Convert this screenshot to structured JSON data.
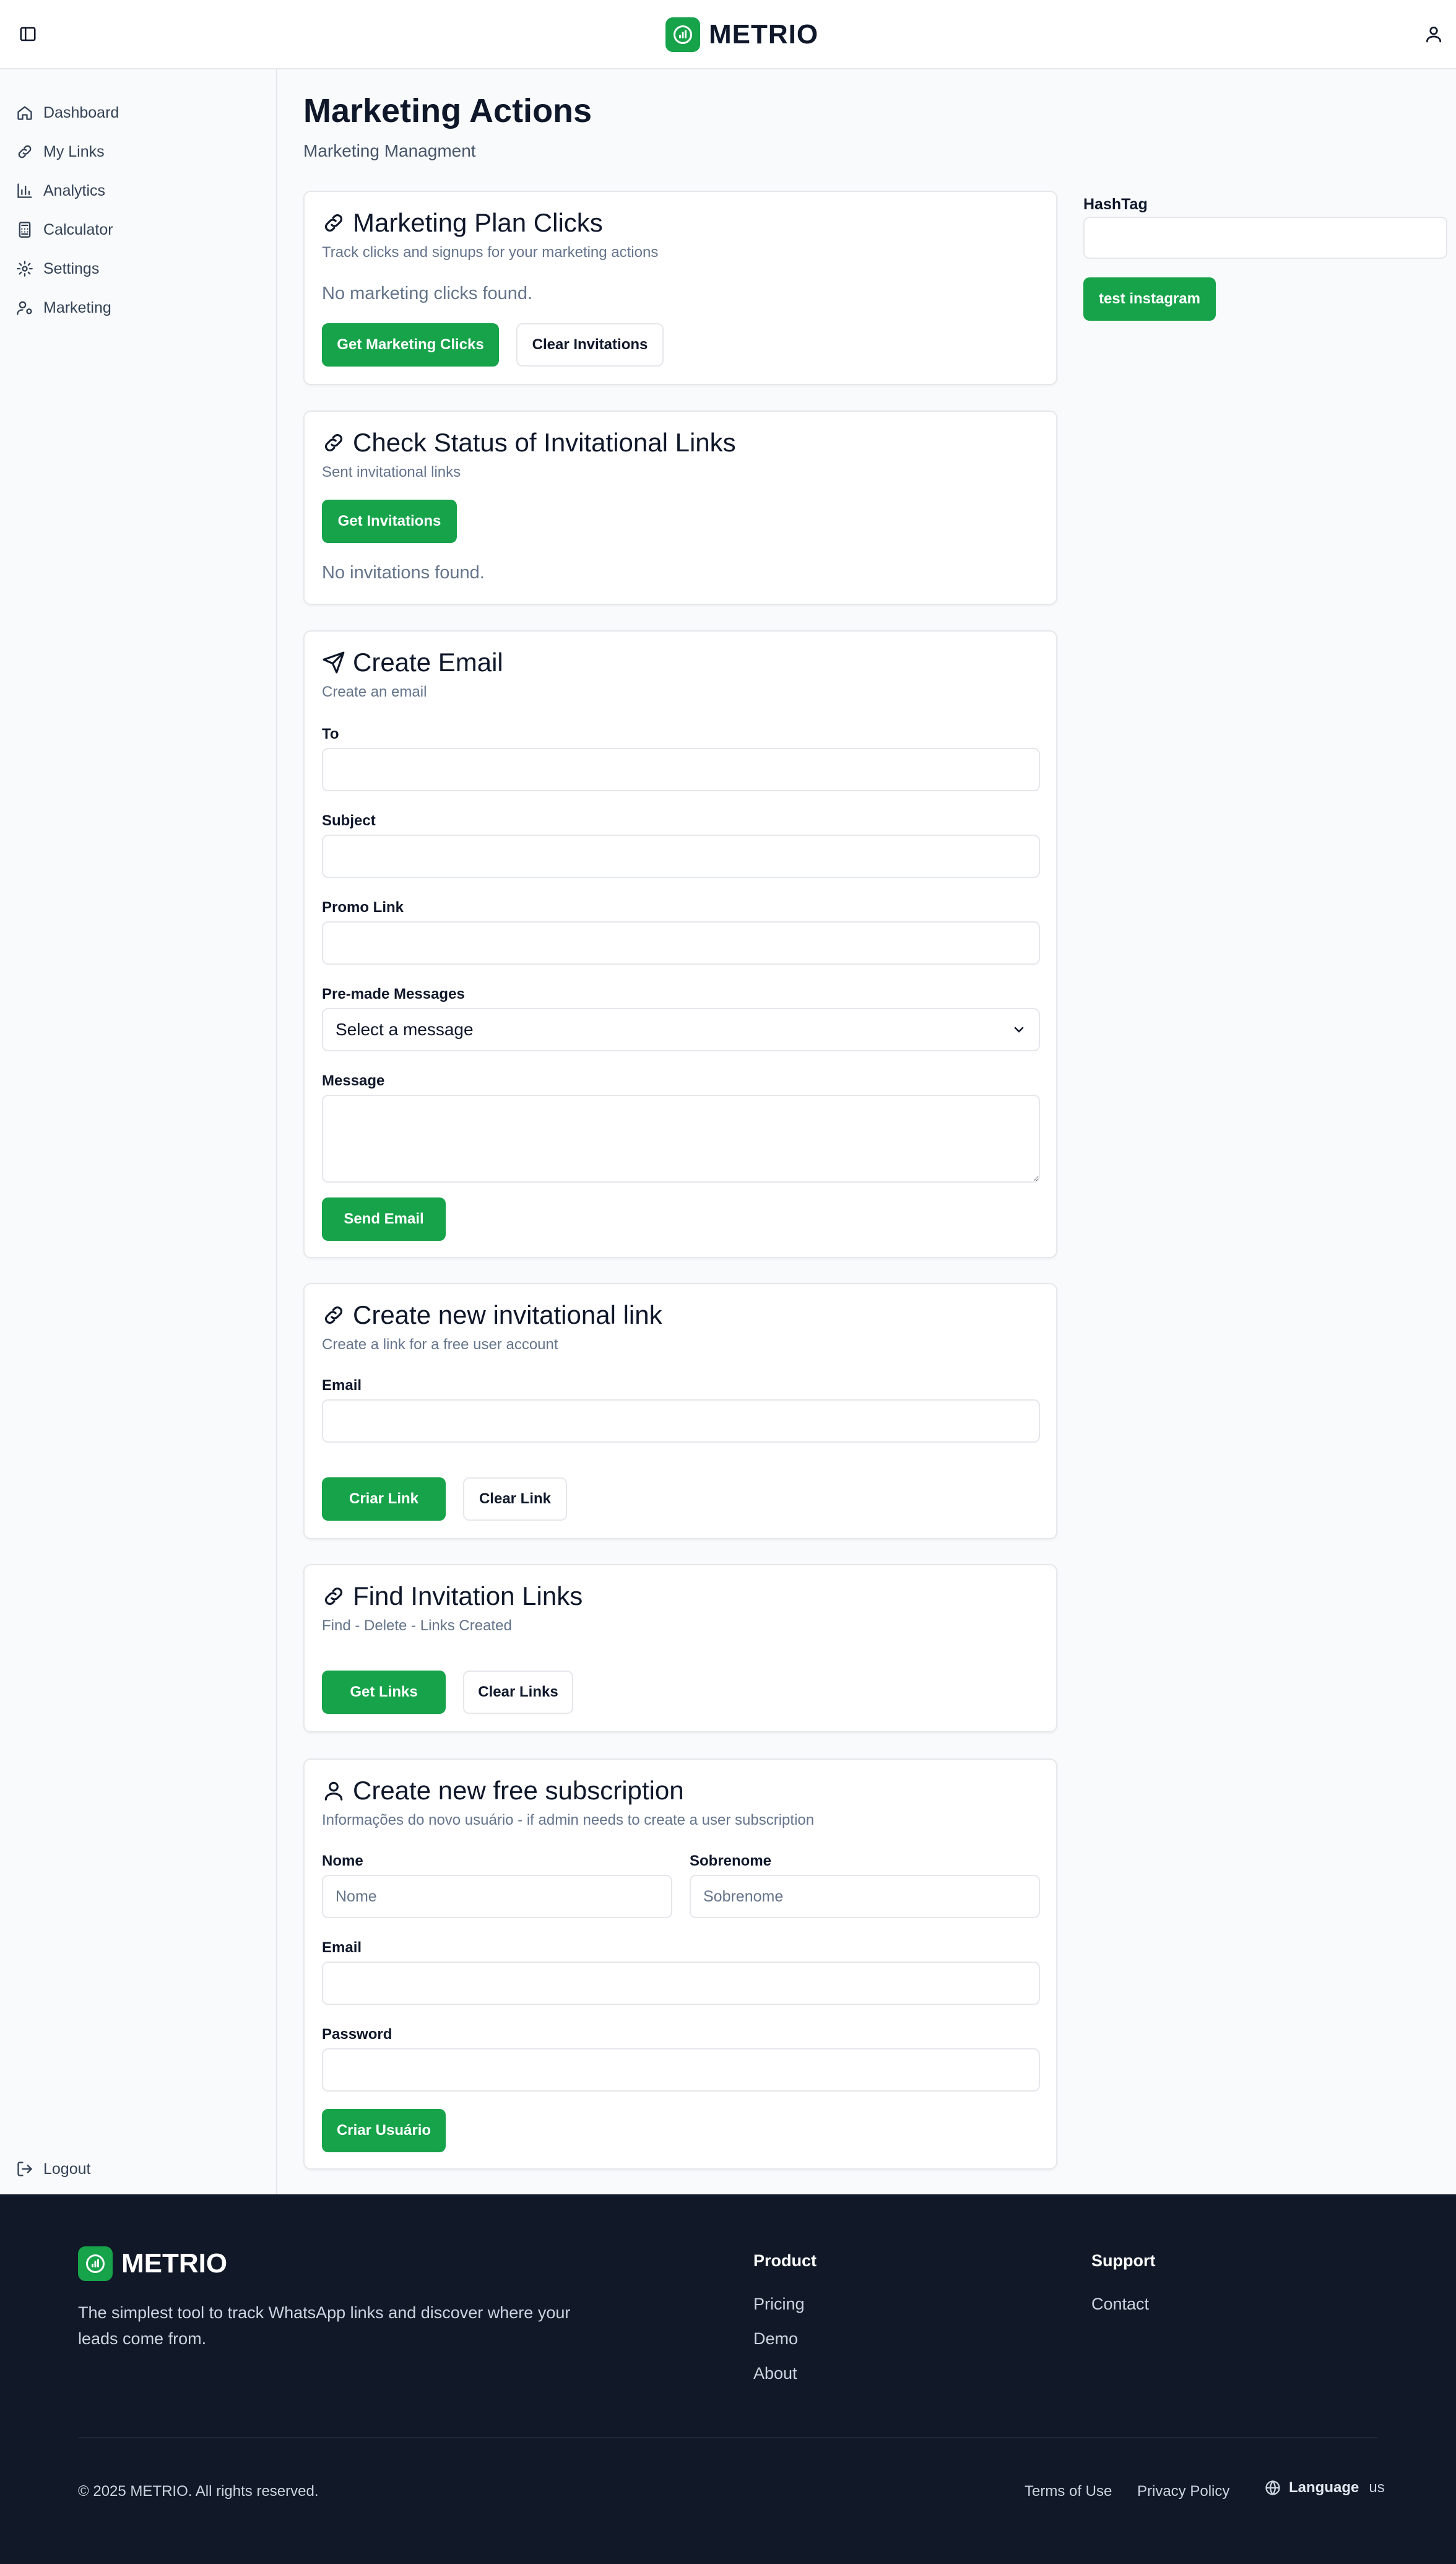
{
  "app": {
    "brand": "METRIO",
    "accent_color": "#16a34a"
  },
  "sidebar": {
    "items": [
      {
        "label": "Dashboard",
        "icon": "home-icon"
      },
      {
        "label": "My Links",
        "icon": "link-icon"
      },
      {
        "label": "Analytics",
        "icon": "bar-chart-icon"
      },
      {
        "label": "Calculator",
        "icon": "calculator-icon"
      },
      {
        "label": "Settings",
        "icon": "gear-icon"
      },
      {
        "label": "Marketing",
        "icon": "user-cog-icon"
      }
    ],
    "logout": "Logout"
  },
  "page": {
    "title": "Marketing Actions",
    "subtitle": "Marketing Managment"
  },
  "marketing_clicks": {
    "title": "Marketing Plan Clicks",
    "subtitle": "Track clicks and signups for your marketing actions",
    "empty": "No marketing clicks found.",
    "get_button": "Get Marketing Clicks",
    "clear_button": "Clear Invitations"
  },
  "invitation_status": {
    "title": "Check Status of Invitational Links",
    "subtitle": "Sent invitational links",
    "get_button": "Get Invitations",
    "empty": "No invitations found."
  },
  "create_email": {
    "title": "Create Email",
    "subtitle": "Create an email",
    "to_label": "To",
    "subject_label": "Subject",
    "promo_label": "Promo Link",
    "premade_label": "Pre-made Messages",
    "premade_selected": "Select a message",
    "message_label": "Message",
    "send_button": "Send Email"
  },
  "new_invite_link": {
    "title": "Create new invitational link",
    "subtitle": "Create a link for a free user account",
    "email_label": "Email",
    "create_button": "Criar Link",
    "clear_button": "Clear Link"
  },
  "find_links": {
    "title": "Find Invitation Links",
    "subtitle": "Find - Delete - Links Created",
    "get_button": "Get Links",
    "clear_button": "Clear Links"
  },
  "free_subscription": {
    "title": "Create new free subscription",
    "subtitle": "Informações do novo usuário - if admin needs to create a user subscription",
    "first_name_label": "Nome",
    "first_name_placeholder": "Nome",
    "last_name_label": "Sobrenome",
    "last_name_placeholder": "Sobrenome",
    "email_label": "Email",
    "password_label": "Password",
    "create_button": "Criar Usuário"
  },
  "right_panel": {
    "hashtag_label": "HashTag",
    "instagram_button": "test instagram"
  },
  "footer": {
    "brand": "METRIO",
    "tagline": "The simplest tool to track WhatsApp links and discover where your leads come from.",
    "product_title": "Product",
    "product_links": [
      "Pricing",
      "Demo",
      "About"
    ],
    "support_title": "Support",
    "support_links": [
      "Contact"
    ],
    "copyright": "© 2025 METRIO. All rights reserved.",
    "terms": "Terms of Use",
    "privacy": "Privacy Policy",
    "language_label": "Language",
    "language_value": "us"
  }
}
